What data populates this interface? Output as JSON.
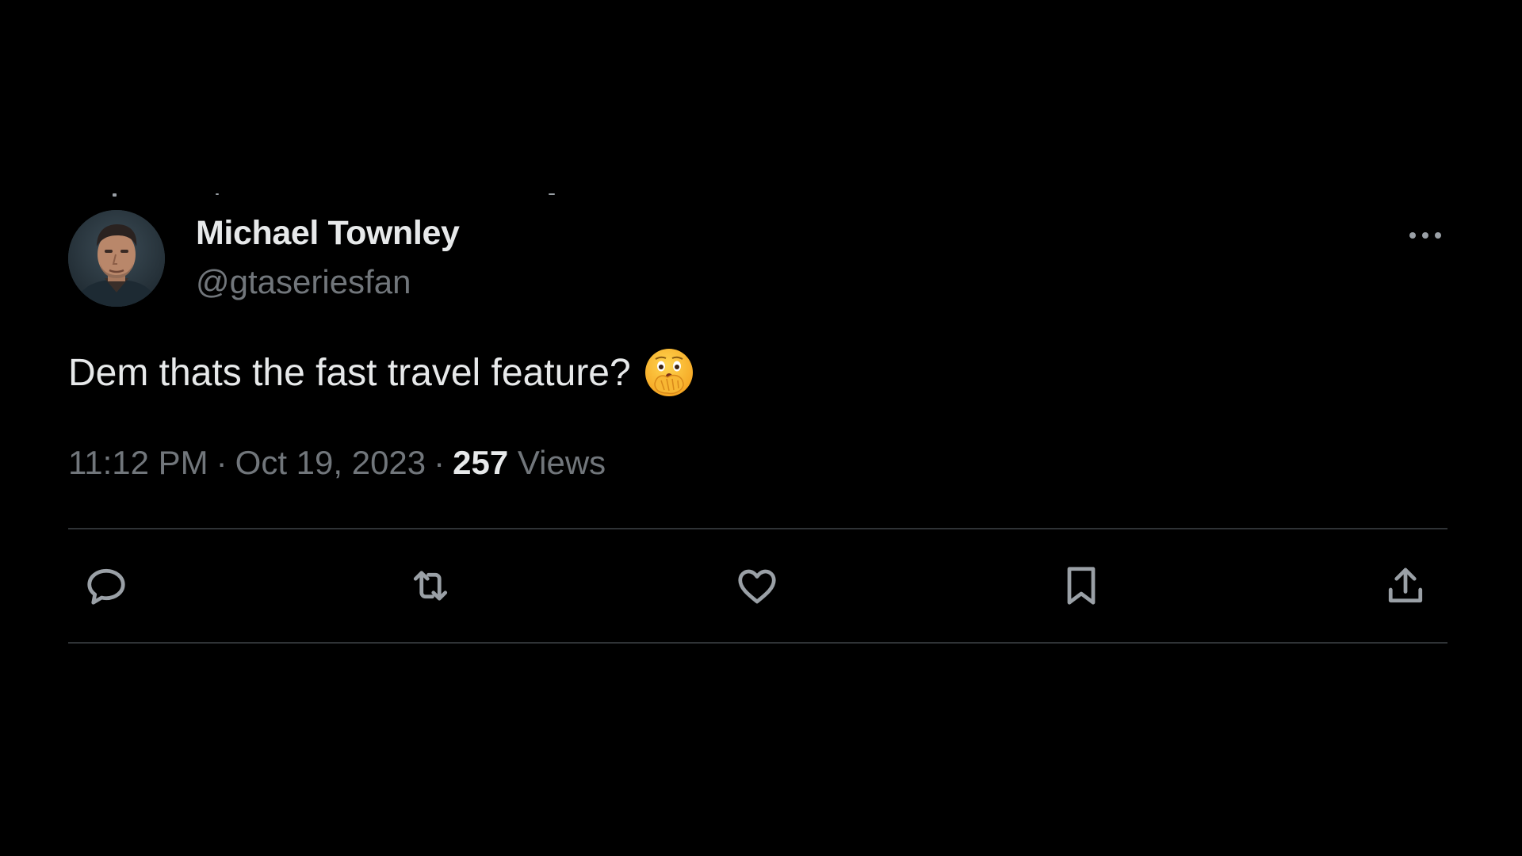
{
  "tweet": {
    "author": {
      "name": "Michael Townley",
      "handle": "@gtaseriesfan",
      "avatar_icon": "avatar-portrait"
    },
    "text": "Dem thats the fast travel feature?",
    "emoji": "face-with-open-eyes-and-hand-over-mouth",
    "time": "11:12 PM",
    "separator": "·",
    "date": "Oct 19, 2023",
    "views_count": "257",
    "views_label": "Views"
  },
  "actions": [
    {
      "name": "reply",
      "icon": "reply-icon"
    },
    {
      "name": "retweet",
      "icon": "retweet-icon"
    },
    {
      "name": "like",
      "icon": "heart-icon"
    },
    {
      "name": "bookmark",
      "icon": "bookmark-icon"
    },
    {
      "name": "share",
      "icon": "share-icon"
    }
  ],
  "colors": {
    "background": "#000000",
    "text_primary": "#e7e9ea",
    "text_secondary": "#71767b",
    "divider": "#2f3336",
    "icon": "#9aa0a6"
  }
}
